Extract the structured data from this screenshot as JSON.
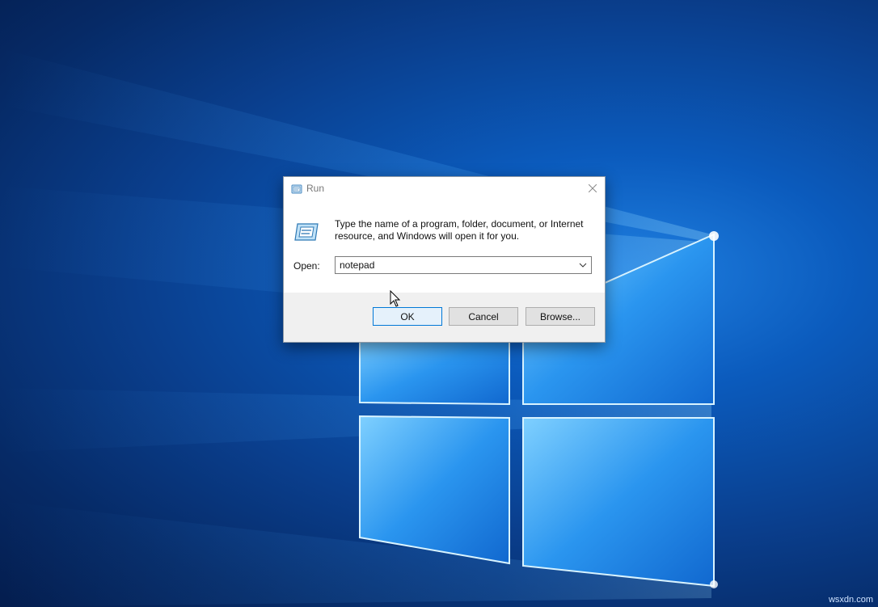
{
  "dialog": {
    "title": "Run",
    "description": "Type the name of a program, folder, document, or Internet resource, and Windows will open it for you.",
    "open_label": "Open:",
    "open_value": "notepad",
    "buttons": {
      "ok": "OK",
      "cancel": "Cancel",
      "browse": "Browse..."
    },
    "icons": {
      "title": "run-icon",
      "body": "run-icon",
      "close": "close-icon",
      "dropdown": "chevron-down-icon"
    }
  },
  "desktop": {
    "wallpaper": "windows-10-hero",
    "accent_color": "#0078d7"
  },
  "watermark": "wsxdn.com"
}
